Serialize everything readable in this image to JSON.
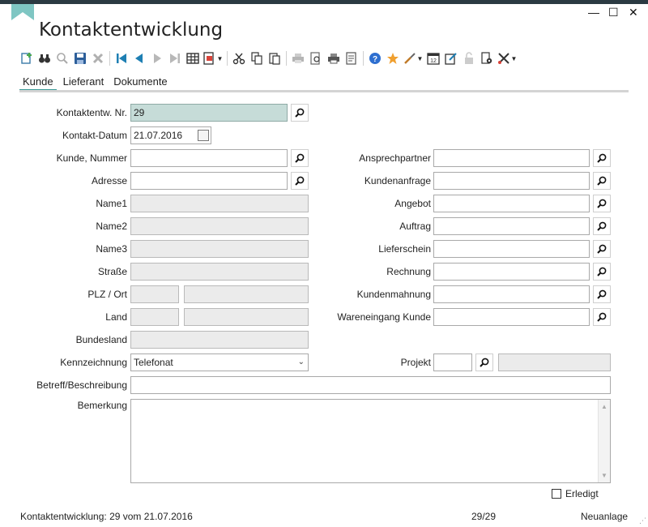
{
  "window": {
    "title": "Kontaktentwicklung",
    "minimize_glyph": "—",
    "maximize_glyph": "☐",
    "close_glyph": "✕"
  },
  "toolbar": {
    "icons": [
      "new-record-icon",
      "binoculars-icon",
      "magnifier-icon",
      "save-icon",
      "delete-icon",
      "first-record-icon",
      "previous-record-icon",
      "next-record-icon",
      "last-record-icon",
      "table-view-icon",
      "export-icon",
      "cut-icon",
      "copy-icon",
      "paste-icon",
      "print-icon",
      "print-preview-icon",
      "print-setup-icon",
      "document-preview-icon",
      "help-icon",
      "favorite-star-icon",
      "tools-icon",
      "calendar-icon",
      "edit-icon",
      "lock-icon",
      "settings-icon",
      "wrench-icon"
    ]
  },
  "tabs": [
    "Kunde",
    "Lieferant",
    "Dokumente"
  ],
  "form": {
    "nr_label": "Kontaktentw. Nr.",
    "nr_value": "29",
    "datum_label": "Kontakt-Datum",
    "datum_value": "21.07.2016",
    "kunde_nummer_label": "Kunde, Nummer",
    "kunde_nummer_value": "",
    "adresse_label": "Adresse",
    "adresse_value": "",
    "name1_label": "Name1",
    "name2_label": "Name2",
    "name3_label": "Name3",
    "strasse_label": "Straße",
    "plz_ort_label": "PLZ / Ort",
    "land_label": "Land",
    "bundesland_label": "Bundesland",
    "kennzeichnung_label": "Kennzeichnung",
    "kennzeichnung_value": "Telefonat",
    "betreff_label": "Betreff/Beschreibung",
    "bemerkung_label": "Bemerkung",
    "ansprechpartner_label": "Ansprechpartner",
    "kundenanfrage_label": "Kundenanfrage",
    "angebot_label": "Angebot",
    "auftrag_label": "Auftrag",
    "lieferschein_label": "Lieferschein",
    "rechnung_label": "Rechnung",
    "kundenmahnung_label": "Kundenmahnung",
    "wareneingang_label": "Wareneingang Kunde",
    "projekt_label": "Projekt",
    "erledigt_label": "Erledigt"
  },
  "status": {
    "left": "Kontaktentwicklung: 29 vom 21.07.2016",
    "center": "29/29",
    "right": "Neuanlage"
  },
  "colors": {
    "accent": "#3a9a97",
    "highlight_field": "#c6dcd8",
    "readonly_field": "#ebebeb",
    "topbar": "#2b3a42"
  }
}
